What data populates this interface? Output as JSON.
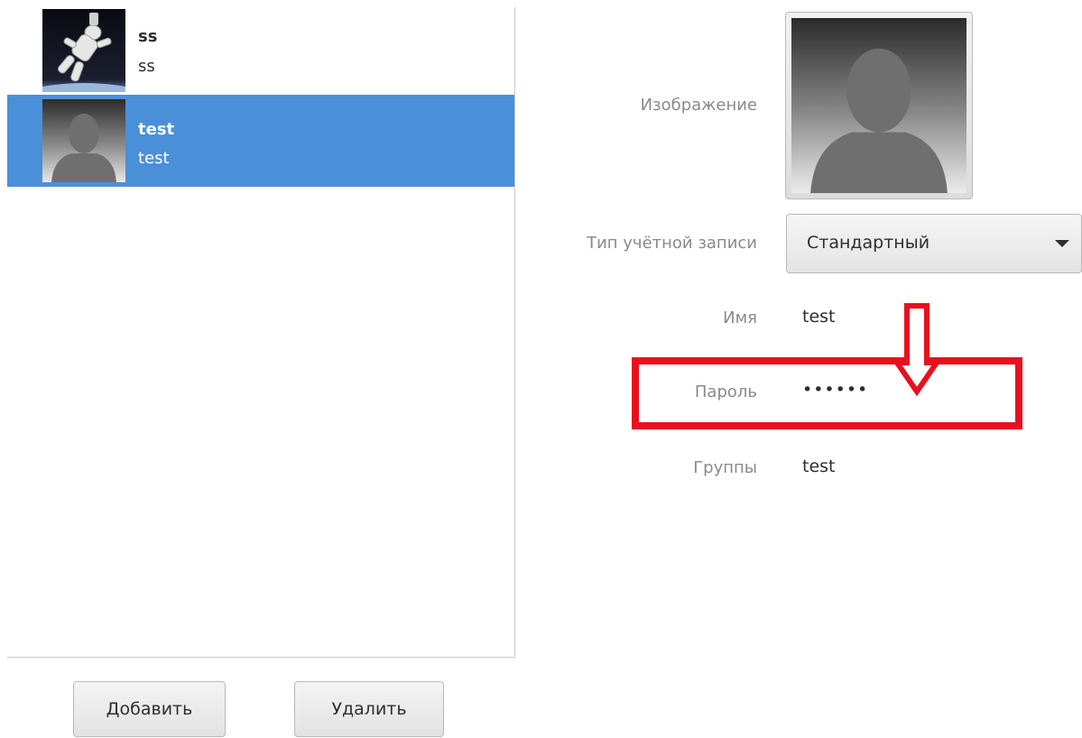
{
  "users": [
    {
      "username": "ss",
      "full_name": "ss",
      "avatar": "astronaut-avatar"
    },
    {
      "username": "test",
      "full_name": "test",
      "avatar": "default-silhouette-avatar",
      "selected": true
    }
  ],
  "buttons": {
    "add": "Добавить",
    "remove": "Удалить"
  },
  "details": {
    "picture_label": "Изображение",
    "account_type_label": "Тип учётной записи",
    "account_type_value": "Стандартный",
    "name_label": "Имя",
    "name_value": "test",
    "password_label": "Пароль",
    "password_value": "••••••",
    "groups_label": "Группы",
    "groups_value": "test"
  },
  "colors": {
    "selection": "#4a90d9",
    "annotation": "#e8101e"
  },
  "icons": {
    "dropdown": "triangle-down-icon",
    "annotation_arrow": "arrow-down-icon"
  }
}
